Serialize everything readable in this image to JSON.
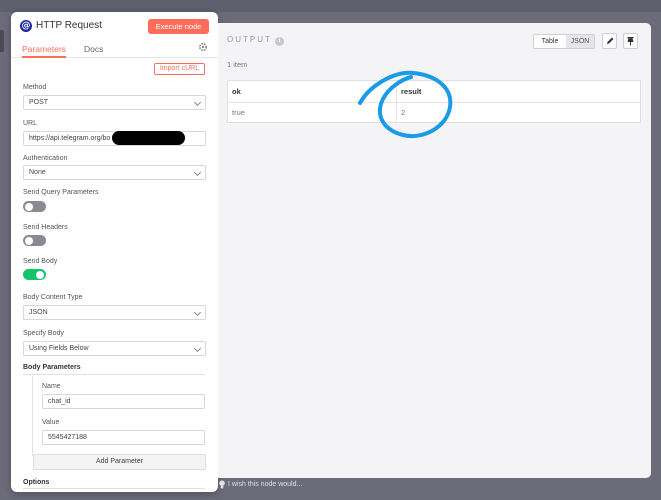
{
  "node": {
    "icon": "globe-icon",
    "title": "HTTP Request",
    "execute_label": "Execute node"
  },
  "tabs": {
    "parameters": "Parameters",
    "docs": "Docs"
  },
  "import_curl_label": "Import cURL",
  "params": {
    "method_label": "Method",
    "method_value": "POST",
    "url_label": "URL",
    "url_value": "https://api.telegram.org/bo",
    "auth_label": "Authentication",
    "auth_value": "None",
    "query_label": "Send Query Parameters",
    "query_enabled": false,
    "headers_label": "Send Headers",
    "headers_enabled": false,
    "body_label": "Send Body",
    "body_enabled": true,
    "content_type_label": "Body Content Type",
    "content_type_value": "JSON",
    "specify_label": "Specify Body",
    "specify_value": "Using Fields Below",
    "body_params_label": "Body Parameters",
    "name_label": "Name",
    "name_value": "chat_id",
    "value_label": "Value",
    "value_value": "5545427188",
    "add_param_label": "Add Parameter",
    "options_label": "Options"
  },
  "output": {
    "title": "OUTPUT",
    "view_table": "Table",
    "view_json": "JSON",
    "item_count": "1 item",
    "columns": [
      "ok",
      "result"
    ],
    "rows": [
      [
        "true",
        "2"
      ]
    ],
    "annotation_color": "#1a9be6"
  },
  "footer": {
    "wish_text": "I wish this node would..."
  },
  "colors": {
    "accent": "#ff6d5a",
    "toggle_on": "#13c46f"
  }
}
